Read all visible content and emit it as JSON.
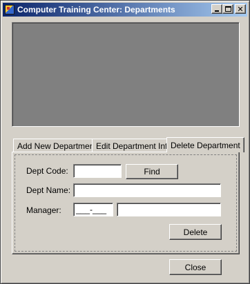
{
  "window": {
    "title": "Computer Training Center: Departments",
    "caption_buttons": {
      "minimize": "minimize-icon",
      "maximize": "maximize-icon",
      "close": "close-icon"
    }
  },
  "tabs": [
    {
      "label": "Add New Department",
      "active": false
    },
    {
      "label": "Edit Department Info",
      "active": false
    },
    {
      "label": "Delete Department",
      "active": true
    }
  ],
  "form": {
    "dept_code_label": "Dept Code:",
    "dept_code_value": "",
    "find_label": "Find",
    "dept_name_label": "Dept Name:",
    "dept_name_value": "",
    "manager_label": "Manager:",
    "manager_id_mask": "___-___",
    "manager_name_value": "",
    "delete_label": "Delete"
  },
  "footer": {
    "close_label": "Close"
  },
  "colors": {
    "face": "#d4d0c8",
    "title_start": "#0a246a",
    "title_end": "#a6caf0",
    "display_area": "#808080"
  }
}
